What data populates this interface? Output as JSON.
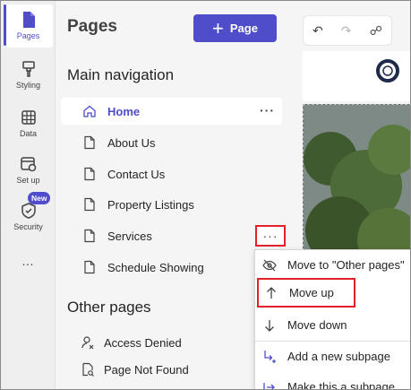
{
  "rail": {
    "items": [
      {
        "label": "Pages",
        "icon": "page-icon"
      },
      {
        "label": "Styling",
        "icon": "brush-icon"
      },
      {
        "label": "Data",
        "icon": "table-icon"
      },
      {
        "label": "Set up",
        "icon": "settings-window-icon"
      },
      {
        "label": "Security",
        "icon": "shield-icon"
      }
    ],
    "new_badge": "New",
    "more": "…"
  },
  "panel": {
    "title": "Pages",
    "add_button": "Page",
    "main_nav_title": "Main navigation",
    "main_nav": [
      {
        "label": "Home"
      },
      {
        "label": "About Us"
      },
      {
        "label": "Contact Us"
      },
      {
        "label": "Property Listings"
      },
      {
        "label": "Services"
      },
      {
        "label": "Schedule Showing"
      }
    ],
    "other_title": "Other pages",
    "other_pages": [
      {
        "label": "Access Denied"
      },
      {
        "label": "Page Not Found"
      }
    ],
    "dots": "···"
  },
  "menu": {
    "items": [
      {
        "label": "Move to \"Other pages\""
      },
      {
        "label": "Move up"
      },
      {
        "label": "Move down"
      },
      {
        "label": "Add a new subpage"
      },
      {
        "label": "Make this a subpage"
      }
    ]
  },
  "colors": {
    "accent": "#4f4dc9",
    "highlight": "#e0212b"
  }
}
